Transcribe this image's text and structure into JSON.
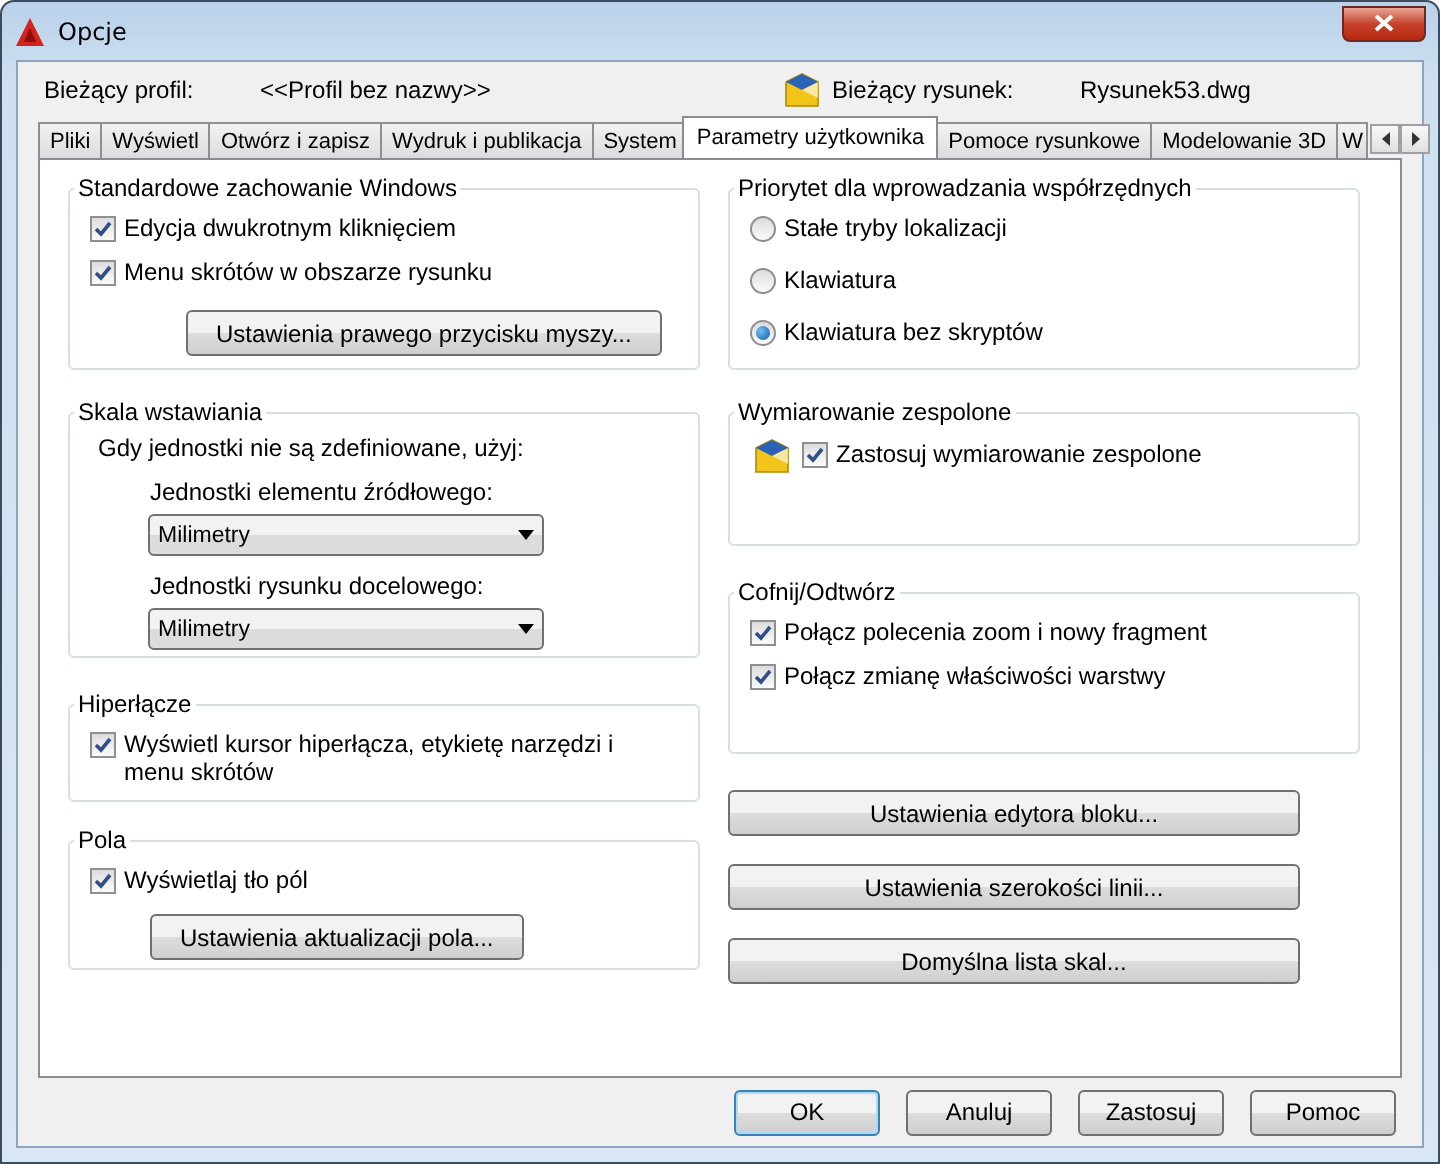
{
  "window": {
    "title": "Opcje"
  },
  "profile": {
    "label": "Bieżący profil:",
    "value": "<<Profil bez nazwy>>"
  },
  "drawing": {
    "label": "Bieżący rysunek:",
    "value": "Rysunek53.dwg"
  },
  "tabs": [
    {
      "label": "Pliki",
      "selected": false
    },
    {
      "label": "Wyświetl",
      "selected": false
    },
    {
      "label": "Otwórz i zapisz",
      "selected": false
    },
    {
      "label": "Wydruk i publikacja",
      "selected": false
    },
    {
      "label": "System",
      "selected": false
    },
    {
      "label": "Parametry użytkownika",
      "selected": true
    },
    {
      "label": "Pomoce rysunkowe",
      "selected": false
    },
    {
      "label": "Modelowanie 3D",
      "selected": false
    },
    {
      "label": "W",
      "selected": false
    }
  ],
  "left_groups": [
    {
      "title": "Standardowe zachowanie Windows",
      "items": [
        {
          "kind": "checkbox",
          "label": "Edycja dwukrotnym kliknięciem",
          "checked": true
        },
        {
          "kind": "checkbox",
          "label": "Menu skrótów w obszarze rysunku",
          "checked": true
        },
        {
          "kind": "button",
          "label": "Ustawienia prawego przycisku myszy..."
        }
      ]
    },
    {
      "title": "Skala wstawiania",
      "items": [
        {
          "kind": "text",
          "label": "Gdy jednostki nie są zdefiniowane, użyj:"
        },
        {
          "kind": "dropdown",
          "label": "Jednostki elementu źródłowego:",
          "value": "Milimetry"
        },
        {
          "kind": "dropdown",
          "label": "Jednostki rysunku docelowego:",
          "value": "Milimetry"
        }
      ]
    },
    {
      "title": "Hiperłącze",
      "items": [
        {
          "kind": "checkbox",
          "label": "Wyświetl kursor hiperłącza, etykietę narzędzi i menu skrótów",
          "checked": true
        }
      ]
    },
    {
      "title": "Pola",
      "items": [
        {
          "kind": "checkbox",
          "label": "Wyświetlaj tło pól",
          "checked": true
        },
        {
          "kind": "button",
          "label": "Ustawienia aktualizacji pola..."
        }
      ]
    }
  ],
  "right_groups": [
    {
      "title": "Priorytet dla wprowadzania współrzędnych",
      "items": [
        {
          "kind": "radio",
          "label": "Stałe tryby lokalizacji",
          "selected": false
        },
        {
          "kind": "radio",
          "label": "Klawiatura",
          "selected": false
        },
        {
          "kind": "radio",
          "label": "Klawiatura bez skryptów",
          "selected": true
        }
      ]
    },
    {
      "title": "Wymiarowanie zespolone",
      "items": [
        {
          "kind": "icon-checkbox",
          "label": "Zastosuj wymiarowanie zespolone",
          "checked": true
        }
      ]
    },
    {
      "title": "Cofnij/Odtwórz",
      "items": [
        {
          "kind": "checkbox",
          "label": "Połącz polecenia zoom i nowy fragment",
          "checked": true
        },
        {
          "kind": "checkbox",
          "label": "Połącz zmianę właściwości warstwy",
          "checked": true
        }
      ]
    }
  ],
  "right_buttons": [
    "Ustawienia edytora bloku...",
    "Ustawienia szerokości linii...",
    "Domyślna lista skal..."
  ],
  "buttons": [
    {
      "label": "OK",
      "default": true
    },
    {
      "label": "Anuluj",
      "default": false
    },
    {
      "label": "Zastosuj",
      "default": false
    },
    {
      "label": "Pomoc",
      "default": false
    }
  ]
}
